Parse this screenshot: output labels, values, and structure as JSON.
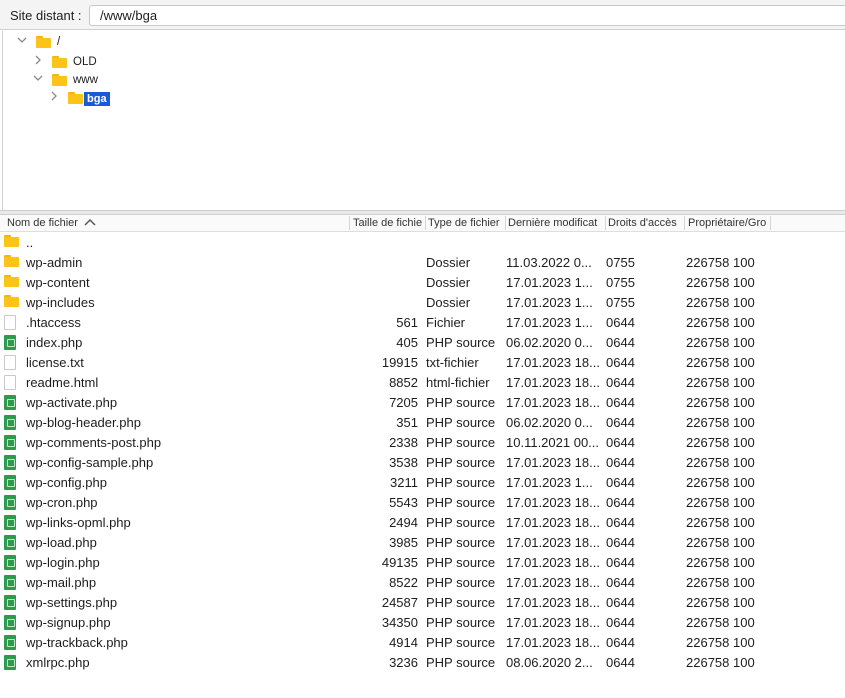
{
  "topbar": {
    "label": "Site distant :",
    "path": "/www/bga"
  },
  "tree": {
    "root": "/",
    "old": "OLD",
    "www": "www",
    "bga": "bga"
  },
  "columns": {
    "name": "Nom de fichier",
    "size": "Taille de fichie",
    "type": "Type de fichier",
    "date": "Dernière modificat",
    "perm": "Droits d'accès",
    "owner": "Propriétaire/Gro"
  },
  "files": [
    {
      "icon": "folder",
      "name": "..",
      "size": "",
      "type": "",
      "date": "",
      "perm": "",
      "owner": ""
    },
    {
      "icon": "folder",
      "name": "wp-admin",
      "size": "",
      "type": "Dossier",
      "date": "11.03.2022 0...",
      "perm": "0755",
      "owner": "226758 100"
    },
    {
      "icon": "folder",
      "name": "wp-content",
      "size": "",
      "type": "Dossier",
      "date": "17.01.2023 1...",
      "perm": "0755",
      "owner": "226758 100"
    },
    {
      "icon": "folder",
      "name": "wp-includes",
      "size": "",
      "type": "Dossier",
      "date": "17.01.2023 1...",
      "perm": "0755",
      "owner": "226758 100"
    },
    {
      "icon": "file",
      "name": ".htaccess",
      "size": "561",
      "type": "Fichier",
      "date": "17.01.2023 1...",
      "perm": "0644",
      "owner": "226758 100"
    },
    {
      "icon": "php",
      "name": "index.php",
      "size": "405",
      "type": "PHP source",
      "date": "06.02.2020 0...",
      "perm": "0644",
      "owner": "226758 100"
    },
    {
      "icon": "file",
      "name": "license.txt",
      "size": "19915",
      "type": "txt-fichier",
      "date": "17.01.2023 18...",
      "perm": "0644",
      "owner": "226758 100"
    },
    {
      "icon": "file",
      "name": "readme.html",
      "size": "8852",
      "type": "html-fichier",
      "date": "17.01.2023 18...",
      "perm": "0644",
      "owner": "226758 100"
    },
    {
      "icon": "php",
      "name": "wp-activate.php",
      "size": "7205",
      "type": "PHP source",
      "date": "17.01.2023 18...",
      "perm": "0644",
      "owner": "226758 100"
    },
    {
      "icon": "php",
      "name": "wp-blog-header.php",
      "size": "351",
      "type": "PHP source",
      "date": "06.02.2020 0...",
      "perm": "0644",
      "owner": "226758 100"
    },
    {
      "icon": "php",
      "name": "wp-comments-post.php",
      "size": "2338",
      "type": "PHP source",
      "date": "10.11.2021 00...",
      "perm": "0644",
      "owner": "226758 100"
    },
    {
      "icon": "php",
      "name": "wp-config-sample.php",
      "size": "3538",
      "type": "PHP source",
      "date": "17.01.2023 18...",
      "perm": "0644",
      "owner": "226758 100"
    },
    {
      "icon": "php",
      "name": "wp-config.php",
      "size": "3211",
      "type": "PHP source",
      "date": "17.01.2023 1...",
      "perm": "0644",
      "owner": "226758 100"
    },
    {
      "icon": "php",
      "name": "wp-cron.php",
      "size": "5543",
      "type": "PHP source",
      "date": "17.01.2023 18...",
      "perm": "0644",
      "owner": "226758 100"
    },
    {
      "icon": "php",
      "name": "wp-links-opml.php",
      "size": "2494",
      "type": "PHP source",
      "date": "17.01.2023 18...",
      "perm": "0644",
      "owner": "226758 100"
    },
    {
      "icon": "php",
      "name": "wp-load.php",
      "size": "3985",
      "type": "PHP source",
      "date": "17.01.2023 18...",
      "perm": "0644",
      "owner": "226758 100"
    },
    {
      "icon": "php",
      "name": "wp-login.php",
      "size": "49135",
      "type": "PHP source",
      "date": "17.01.2023 18...",
      "perm": "0644",
      "owner": "226758 100"
    },
    {
      "icon": "php",
      "name": "wp-mail.php",
      "size": "8522",
      "type": "PHP source",
      "date": "17.01.2023 18...",
      "perm": "0644",
      "owner": "226758 100"
    },
    {
      "icon": "php",
      "name": "wp-settings.php",
      "size": "24587",
      "type": "PHP source",
      "date": "17.01.2023 18...",
      "perm": "0644",
      "owner": "226758 100"
    },
    {
      "icon": "php",
      "name": "wp-signup.php",
      "size": "34350",
      "type": "PHP source",
      "date": "17.01.2023 18...",
      "perm": "0644",
      "owner": "226758 100"
    },
    {
      "icon": "php",
      "name": "wp-trackback.php",
      "size": "4914",
      "type": "PHP source",
      "date": "17.01.2023 18...",
      "perm": "0644",
      "owner": "226758 100"
    },
    {
      "icon": "php",
      "name": "xmlrpc.php",
      "size": "3236",
      "type": "PHP source",
      "date": "08.06.2020 2...",
      "perm": "0644",
      "owner": "226758 100"
    }
  ]
}
